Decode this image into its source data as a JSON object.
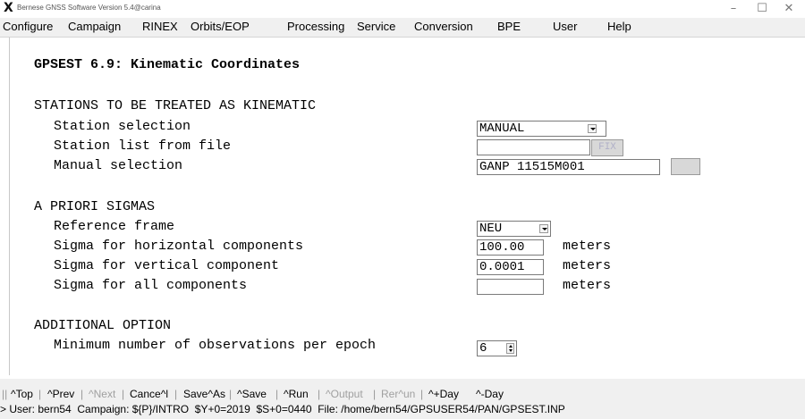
{
  "window": {
    "title": "Bernese GNSS Software Version 5.4@carina",
    "minimize": "–",
    "maximize": "☐",
    "close": "✕"
  },
  "menu": [
    "Configure",
    "Campaign",
    "RINEX",
    "Orbits/EOP",
    "Processing",
    "Service",
    "Conversion",
    "BPE",
    "User",
    "Help"
  ],
  "panel": {
    "heading": "GPSEST 6.9: Kinematic Coordinates",
    "sec1": "STATIONS TO BE TREATED AS KINEMATIC",
    "station_selection_label": "Station selection",
    "station_selection_value": "MANUAL",
    "station_list_label": "Station list from file",
    "station_list_value": "",
    "fix_button": "FIX",
    "manual_selection_label": "Manual selection",
    "manual_selection_value": "GANP 11515M001",
    "sec2": "A PRIORI SIGMAS",
    "ref_frame_label": "Reference frame",
    "ref_frame_value": "NEU",
    "sigma_h_label": "Sigma for horizontal components",
    "sigma_h_value": "100.00",
    "sigma_v_label": "Sigma for vertical component",
    "sigma_v_value": "0.0001",
    "sigma_all_label": "Sigma for all components",
    "sigma_all_value": "",
    "unit": "meters",
    "sec3": "ADDITIONAL OPTION",
    "min_obs_label": "Minimum number of observations per epoch",
    "min_obs_value": "6"
  },
  "commands": {
    "top": "^Top",
    "prev": "^Prev",
    "next": "^Next",
    "cancel": "Cance^l",
    "saveas": "Save^As",
    "save": "^Save",
    "run": "^Run",
    "output": "^Output",
    "rerun": "Rer^un",
    "plusday": "^+Day",
    "minusday": "^-Day"
  },
  "status": "> User: bern54  Campaign: ${P}/INTRO  $Y+0=2019  $S+0=0440  File: /home/bern54/GPSUSER54/PAN/GPSEST.INP"
}
